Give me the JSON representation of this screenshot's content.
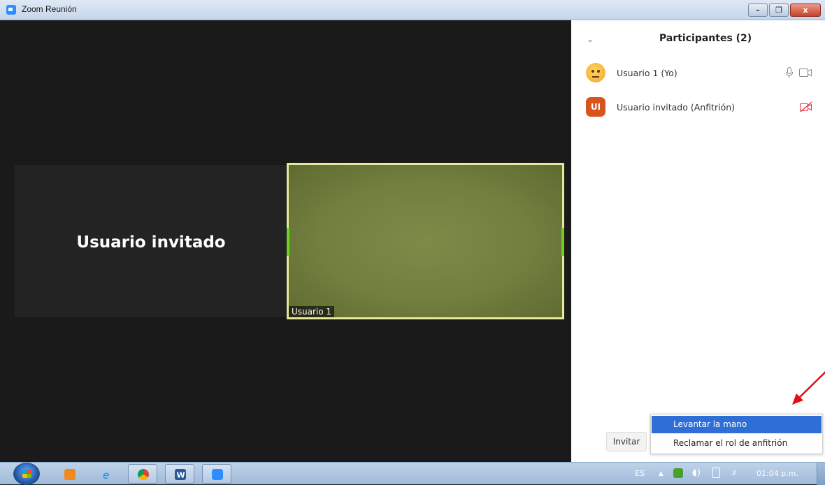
{
  "window": {
    "title": "Zoom Reunión",
    "controls": {
      "minimize": "–",
      "maximize": "❐",
      "close": "x"
    }
  },
  "video": {
    "guest_tile_name": "Usuario invitado",
    "self_tile_label": "Usuario 1"
  },
  "participants": {
    "title": "Participantes (2)",
    "items": [
      {
        "name": "Usuario 1 (Yo)",
        "avatar": "thinking-emoji",
        "mic": "mic-icon",
        "video": "camera-icon"
      },
      {
        "name": "Usuario invitado (Anfitrión)",
        "avatar_initials": "UI",
        "video": "camera-off-icon"
      }
    ],
    "invite_label": "Invitar",
    "menu": [
      "Levantar la mano",
      "Reclamar el rol de anfitrión"
    ]
  },
  "taskbar": {
    "apps": [
      "media-player-icon",
      "internet-explorer-icon",
      "chrome-icon",
      "word-icon",
      "zoom-icon"
    ],
    "language": "ES",
    "clock": "01:04 p.m."
  },
  "colors": {
    "accent_blue": "#2d6fd6",
    "avatar_orange": "#d8541c",
    "active_speaker_border": "#e6e89a",
    "annotation_arrow": "#e01010"
  }
}
